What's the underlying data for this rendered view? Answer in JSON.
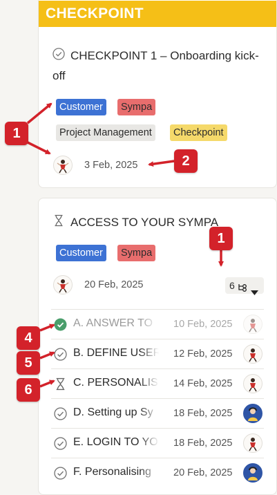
{
  "card1": {
    "header": "CHECKPOINT",
    "title": "CHECKPOINT 1 – Onboarding kick-off",
    "tags": [
      "Customer",
      "Sympa",
      "Project Management",
      "Checkpoint"
    ],
    "date": "3 Feb, 2025"
  },
  "card2": {
    "title": "ACCESS TO YOUR SYMPA",
    "tags": [
      "Customer",
      "Sympa"
    ],
    "date": "20 Feb, 2025",
    "subtask_count": "6",
    "subtasks": [
      {
        "name": "A. ANSWER TO",
        "date": "10 Feb, 2025",
        "status": "done"
      },
      {
        "name": "B. DEFINE USER",
        "date": "12 Feb, 2025",
        "status": "open"
      },
      {
        "name": "C. PERSONALIS",
        "date": "14 Feb, 2025",
        "status": "pending"
      },
      {
        "name": "D. Setting up Sy",
        "date": "18 Feb, 2025",
        "status": "open"
      },
      {
        "name": "E. LOGIN TO YO",
        "date": "18 Feb, 2025",
        "status": "open"
      },
      {
        "name": "F. Personalising",
        "date": "20 Feb, 2025",
        "status": "open"
      }
    ]
  },
  "annotations": [
    "1",
    "2",
    "1",
    "4",
    "5",
    "6"
  ],
  "colors": {
    "header": "#f5bf17",
    "tag_blue": "#3d72d4",
    "tag_red": "#e86d6d",
    "tag_yellow": "#f5d96a",
    "badge": "#d3222a",
    "done_green": "#4a9e6b"
  }
}
